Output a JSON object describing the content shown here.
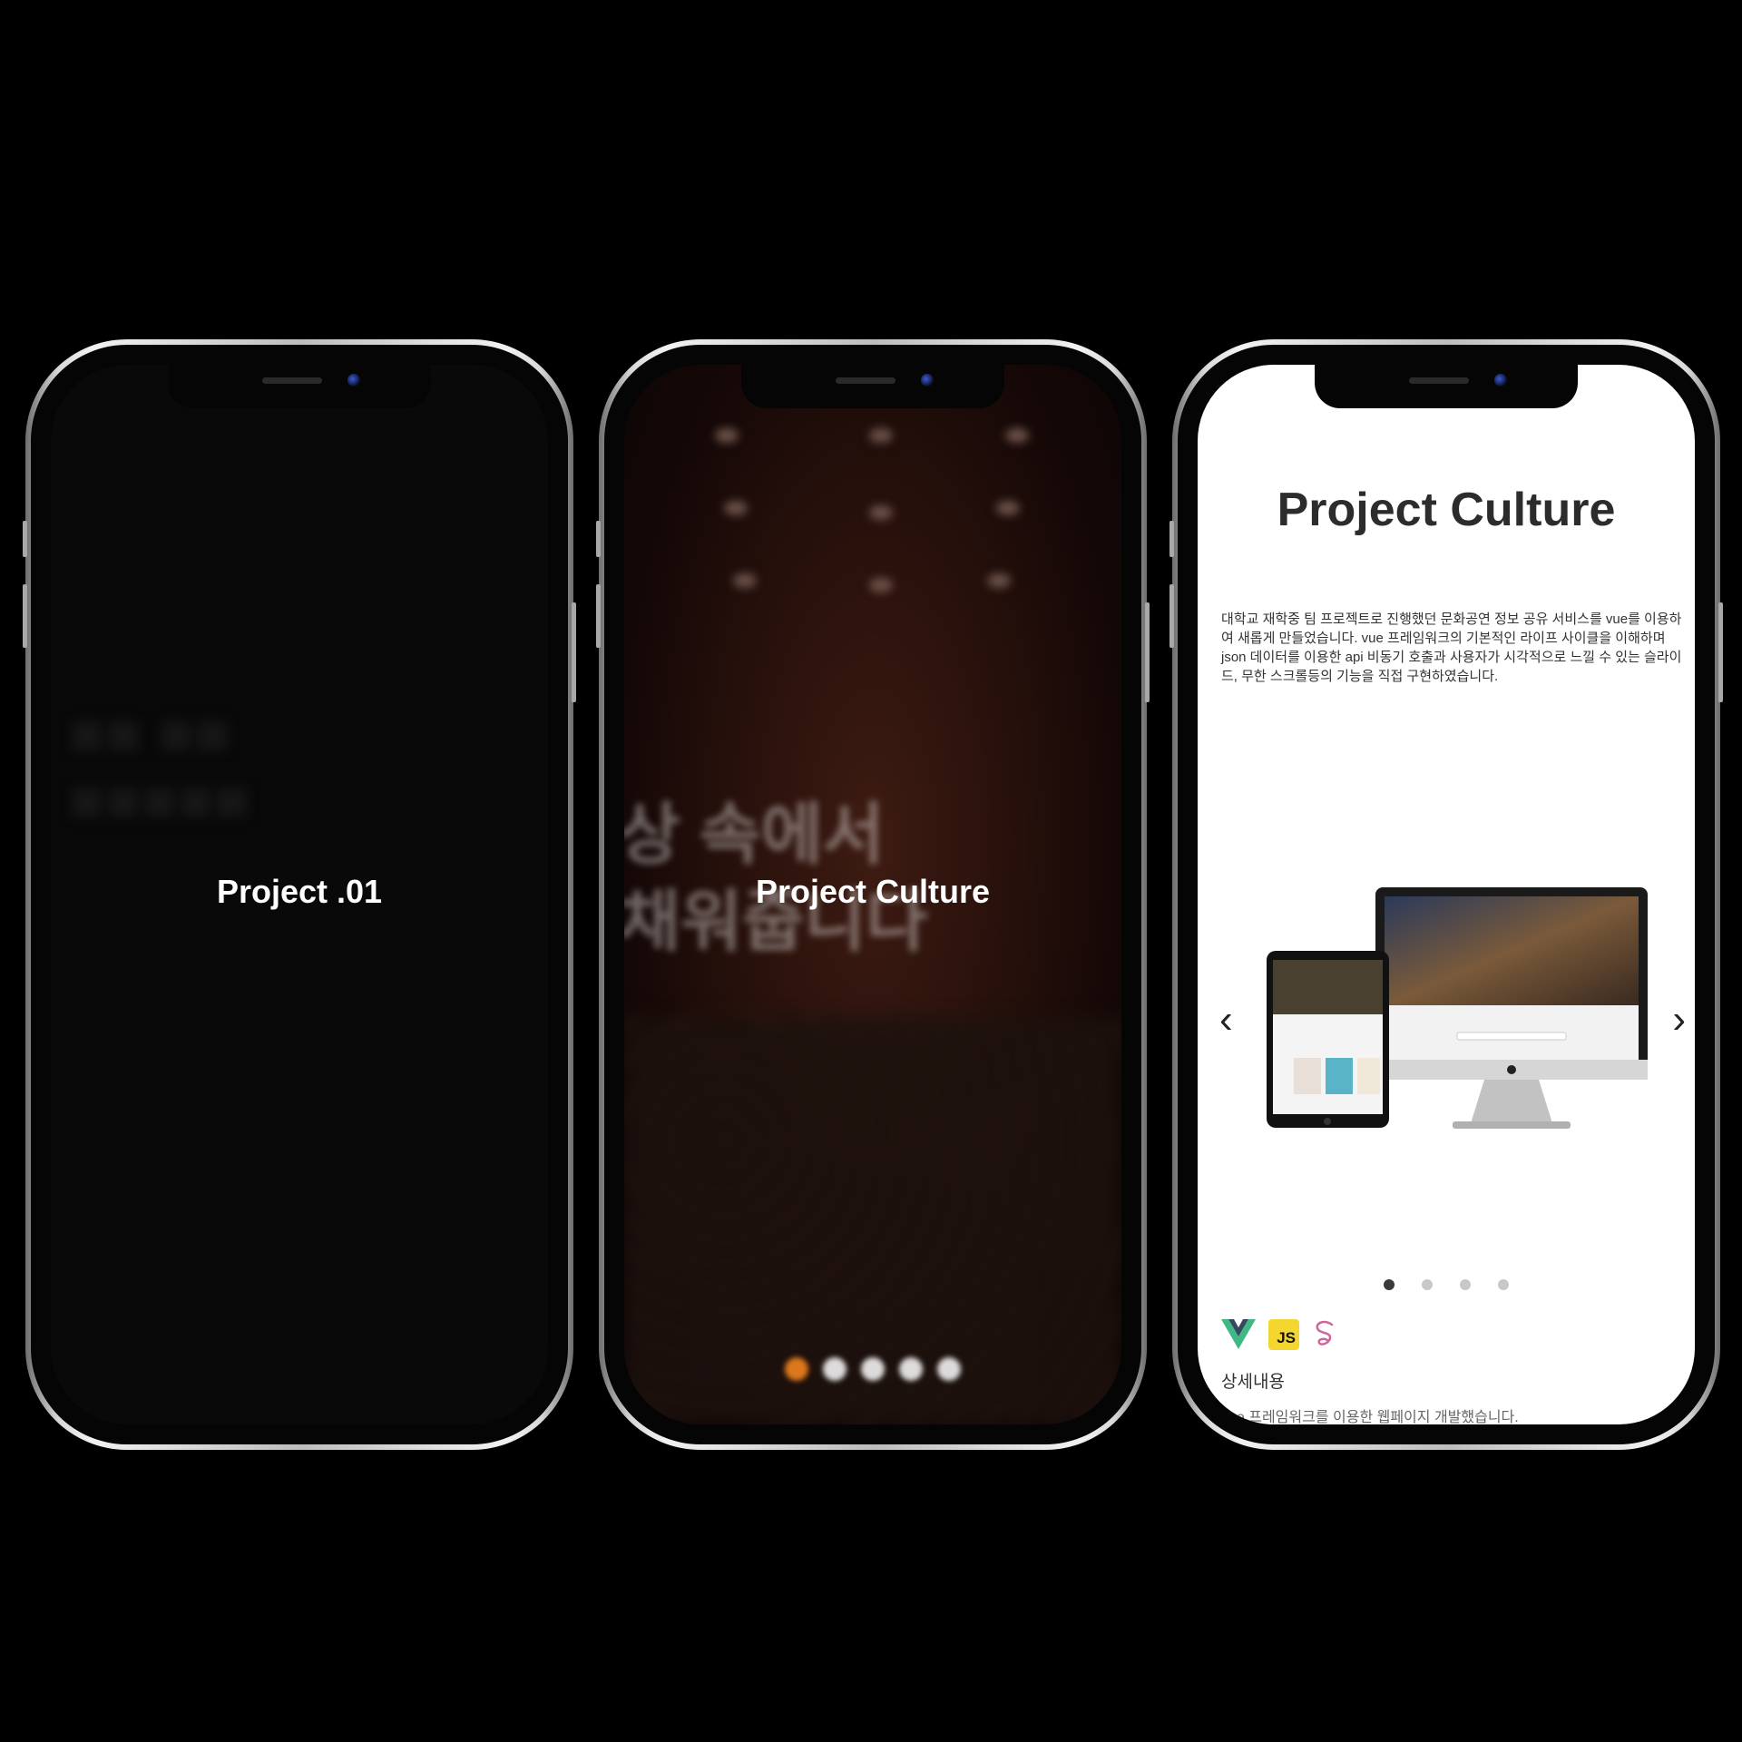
{
  "phones": [
    {
      "title": "Project .01",
      "background": "#090909"
    },
    {
      "title": "Project Culture",
      "background_text": "상 속에서\n채워줍니다",
      "slider_dots": 5,
      "active_dot": 0,
      "accent": "#ff8a1e"
    },
    {
      "title": "Project Culture",
      "description": "대학교 재학중 팀 프로젝트로 진행했던 문화공연 정보 공유 서비스를 vue를 이용하여 새롭게 만들었습니다. vue 프레임워크의 기본적인 라이프 사이클을 이해하며 json 데이터를 이용한 api 비동기 호출과 사용자가 시각적으로 느낄 수 있는 슬라이드, 무한 스크롤등의 기능을 직접 구현하였습니다.",
      "prev_arrow": "‹",
      "next_arrow": "›",
      "carousel_dots": 4,
      "active_dot": 0,
      "tech_icons": [
        "vue-icon",
        "javascript-icon",
        "sass-icon"
      ],
      "js_label": "JS",
      "details_heading": "상세내용",
      "details_text": "vue 프레임워크를 이용한 웹페이지 개발했습니다.",
      "colors": {
        "vue_green": "#41b883",
        "vue_dark": "#35495e",
        "js_yellow": "#f3d730",
        "sass_pink": "#cd6799"
      }
    }
  ]
}
